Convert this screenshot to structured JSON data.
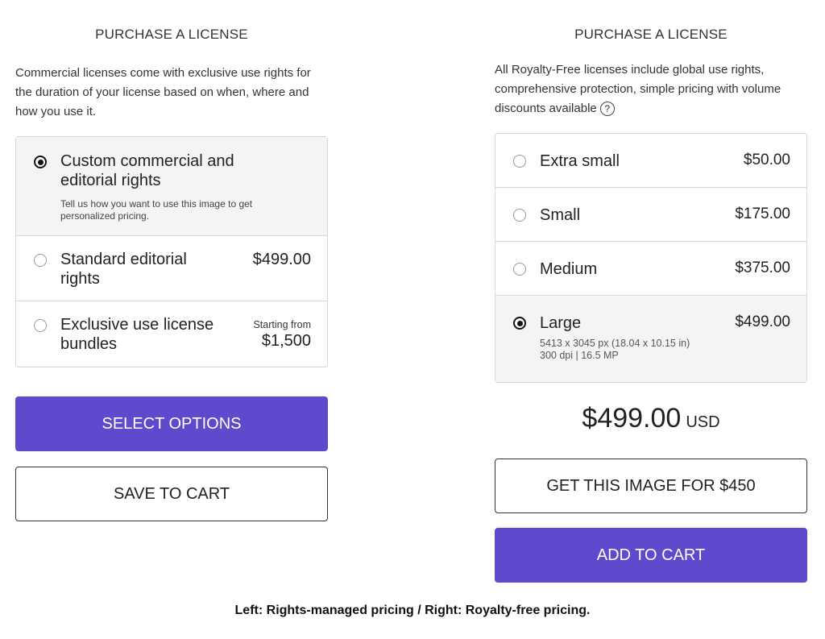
{
  "left": {
    "heading": "PURCHASE A LICENSE",
    "description": "Commercial licenses come with exclusive use rights for the duration of your license based on when, where and how you use it.",
    "options": [
      {
        "label_line1": "Custom commercial and",
        "label_line2": "editorial rights",
        "sub_line1": "Tell us how you want to use this image to get",
        "sub_line2": "personalized pricing.",
        "selected": true
      },
      {
        "label_line1": "Standard editorial",
        "label_line2": "rights",
        "price": "$499.00",
        "selected": false
      },
      {
        "label_line1": "Exclusive use license",
        "label_line2": "bundles",
        "price_prefix": "Starting from",
        "price": "$1,500",
        "selected": false
      }
    ],
    "select_options_label": "SELECT OPTIONS",
    "save_to_cart_label": "SAVE TO CART"
  },
  "right": {
    "heading": "PURCHASE A LICENSE",
    "description": "All Royalty-Free licenses include global use rights, comprehensive protection, simple pricing with volume discounts available",
    "help_icon": "?",
    "options": [
      {
        "label": "Extra small",
        "price": "$50.00",
        "selected": false
      },
      {
        "label": "Small",
        "price": "$175.00",
        "selected": false
      },
      {
        "label": "Medium",
        "price": "$375.00",
        "selected": false
      },
      {
        "label": "Large",
        "price": "$499.00",
        "detail_line1": "5413 x 3045 px (18.04 x 10.15 in)",
        "detail_line2": "300 dpi | 16.5 MP",
        "selected": true
      }
    ],
    "total_amount": "$499.00",
    "total_currency": "USD",
    "get_image_label": "GET THIS IMAGE FOR $450",
    "add_to_cart_label": "ADD TO CART"
  },
  "caption": "Left: Rights-managed pricing / Right: Royalty-free pricing.",
  "colors": {
    "accent": "#6149cd",
    "selected_bg": "#f4f4f4",
    "border": "#d6d6d6"
  }
}
